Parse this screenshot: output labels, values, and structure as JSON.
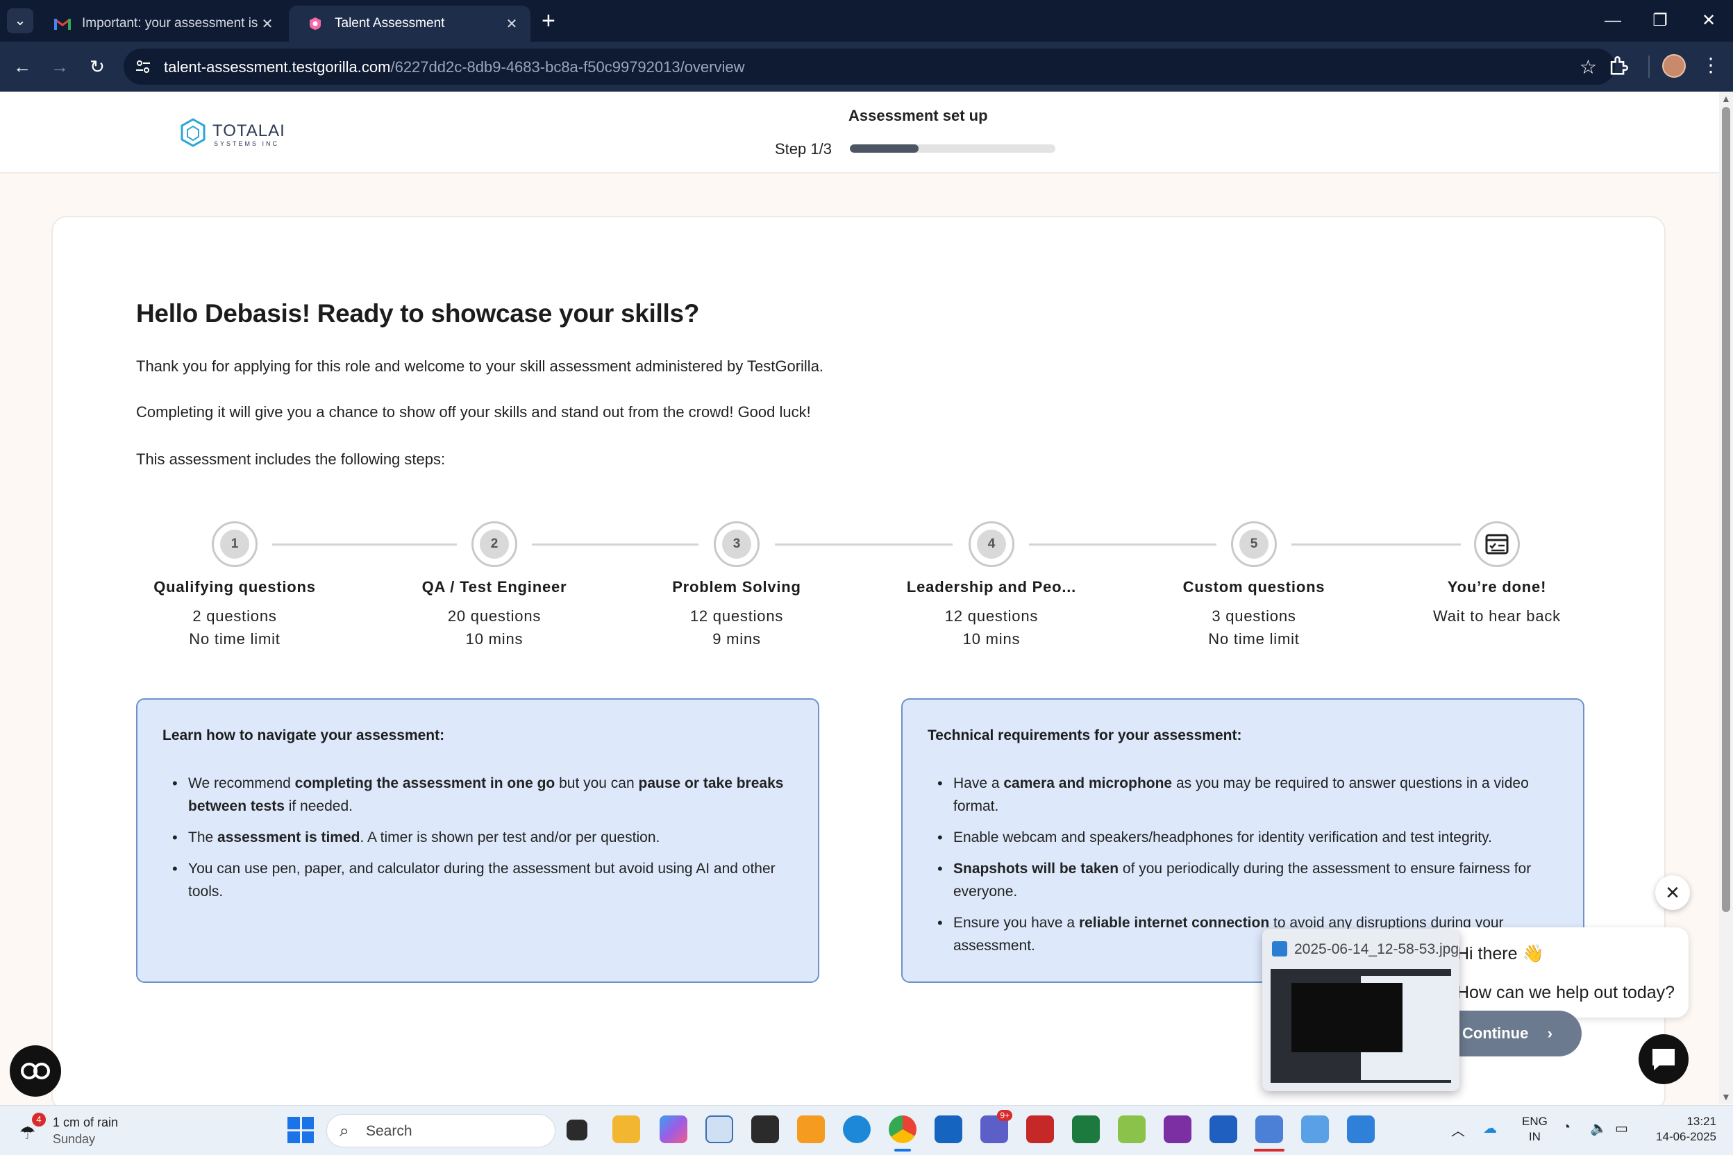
{
  "browser": {
    "tabs": [
      {
        "title": "Important: your assessment is w",
        "active": false,
        "favicon": "gmail-icon"
      },
      {
        "title": "Talent Assessment",
        "active": true,
        "favicon": "testgorilla-icon"
      }
    ],
    "url_host": "talent-assessment.testgorilla.com",
    "url_path": "/6227dd2c-8db9-4683-bc8a-f50c99792013/overview"
  },
  "header": {
    "logo_text": "TOTALAI",
    "logo_sub": "SYSTEMS INC",
    "setup_title": "Assessment set up",
    "step_label": "Step 1/3",
    "progress_fraction": 0.333
  },
  "main": {
    "greeting": "Hello Debasis! Ready to showcase your skills?",
    "para1": "Thank you for applying for this role and welcome to your skill assessment administered by TestGorilla.",
    "para2": "Completing it will give you a chance to show off your skills and stand out from the crowd! Good luck!",
    "para3": "This assessment includes the following steps:",
    "steps": [
      {
        "num": "1",
        "name": "Qualifying questions",
        "count": "2 questions",
        "time": "No time limit"
      },
      {
        "num": "2",
        "name": "QA / Test Engineer",
        "count": "20 questions",
        "time": "10 mins"
      },
      {
        "num": "3",
        "name": "Problem Solving",
        "count": "12 questions",
        "time": "9 mins"
      },
      {
        "num": "4",
        "name": "Leadership and Peo...",
        "count": "12 questions",
        "time": "10 mins"
      },
      {
        "num": "5",
        "name": "Custom questions",
        "count": "3 questions",
        "time": "No time limit"
      },
      {
        "num": "",
        "name": "You’re done!",
        "count": "Wait to hear back",
        "time": ""
      }
    ],
    "navigate_box": {
      "title": "Learn how to navigate your assessment:",
      "b1_pre": "We recommend ",
      "b1_bold1": "completing the assessment in one go",
      "b1_mid": " but you can ",
      "b1_bold2": "pause or take breaks between tests",
      "b1_post": " if needed.",
      "b2_pre": "The ",
      "b2_bold": "assessment is timed",
      "b2_post": ". A timer is shown per test and/or per question.",
      "b3": "You can use pen, paper, and calculator during the assessment but avoid using AI and other tools."
    },
    "tech_box": {
      "title": "Technical requirements for your assessment:",
      "b1_pre": "Have a ",
      "b1_bold": "camera and microphone",
      "b1_post": " as you may be required to answer questions in a video format.",
      "b2": "Enable webcam and speakers/headphones for identity verification and test integrity.",
      "b3_bold": "Snapshots will be taken",
      "b3_post": " of you periodically during the assessment to ensure fairness for everyone.",
      "b4_pre": "Ensure you have a ",
      "b4_bold": "reliable internet connection",
      "b4_post": " to avoid any disruptions during your assessment."
    }
  },
  "chat": {
    "line1": "Hi there 👋",
    "line2": "How can we help out today?",
    "continue_label": "Continue"
  },
  "preview": {
    "filename": "2025-06-14_12-58-53.jpg"
  },
  "taskbar": {
    "weather_line1": "1 cm of rain",
    "weather_line2": "Sunday",
    "weather_badge": "4",
    "search_placeholder": "Search",
    "lang1": "ENG",
    "lang2": "IN",
    "time": "13:21",
    "date": "14-06-2025",
    "teams_badge": "9+"
  }
}
